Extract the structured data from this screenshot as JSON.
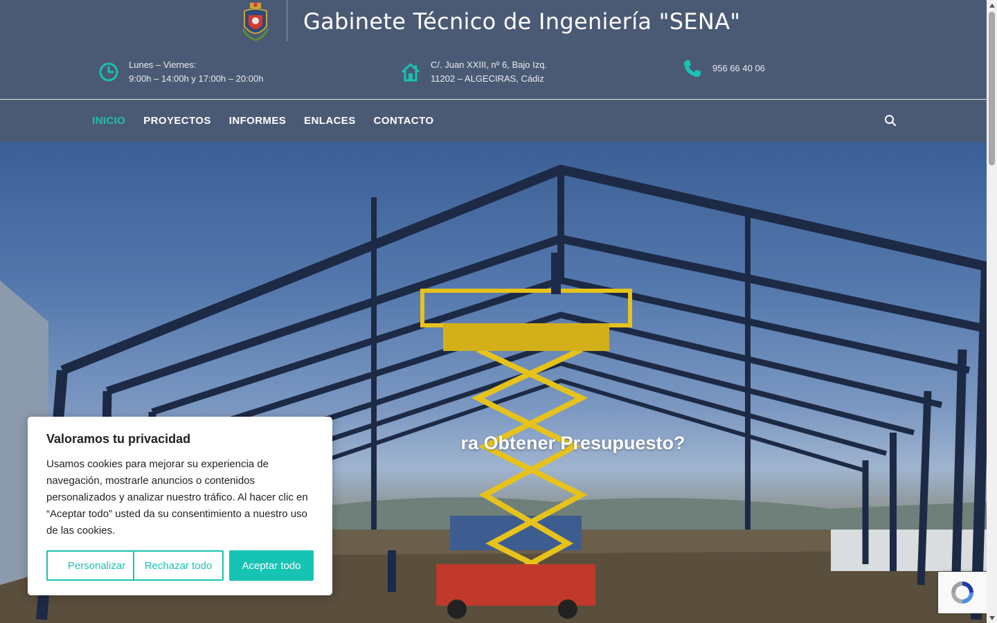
{
  "header": {
    "site_title": "Gabinete Técnico de Ingeniería \"SENA\"",
    "logo_icon": "coat-of-arms-logo",
    "hours": {
      "icon": "clock-icon",
      "line1": "Lunes – Viernes:",
      "line2": "9:00h – 14:00h y 17:00h – 20:00h"
    },
    "address": {
      "icon": "home-icon",
      "line1": "C/. Juan XXIII, nº 6, Bajo Izq.",
      "line2": "11202 – ALGECIRAS, Cádiz"
    },
    "phone": {
      "icon": "phone-icon",
      "number": "956 66 40 06"
    }
  },
  "nav": {
    "items": [
      {
        "label": "INICIO",
        "active": true
      },
      {
        "label": "PROYECTOS",
        "active": false
      },
      {
        "label": "INFORMES",
        "active": false
      },
      {
        "label": "ENLACES",
        "active": false
      },
      {
        "label": "CONTACTO",
        "active": false
      }
    ],
    "search_icon": "search-icon"
  },
  "hero": {
    "heading_visible": "ra Obtener Presupuesto?"
  },
  "cookie_banner": {
    "title": "Valoramos tu privacidad",
    "text": "Usamos cookies para mejorar su experiencia de navegación, mostrarle anuncios o contenidos personalizados y analizar nuestro tráfico. Al hacer clic en “Aceptar todo” usted da su consentimiento a nuestro uso de las cookies.",
    "customize_label": "Personalizar",
    "reject_label": "Rechazar todo",
    "accept_label": "Aceptar todo"
  },
  "colors": {
    "header_bg": "#4b5a74",
    "accent": "#17c3b2",
    "text_light": "#ffffff"
  }
}
